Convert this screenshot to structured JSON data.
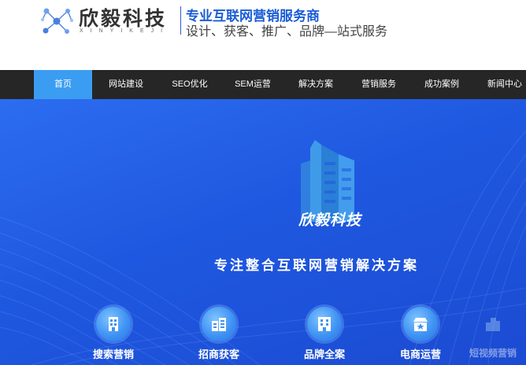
{
  "logo": {
    "name": "欣毅科技",
    "romanized": "XINYIKEJI",
    "icon": "molecule-network-icon"
  },
  "header": {
    "slogan_main": "专业互联网营销服务商",
    "slogan_sub": "设计、获客、推广、品牌—站式服务"
  },
  "nav": {
    "items": [
      {
        "label": "首页",
        "active": true
      },
      {
        "label": "网站建设"
      },
      {
        "label": "SEO优化"
      },
      {
        "label": "SEM运营"
      },
      {
        "label": "解决方案"
      },
      {
        "label": "营销服务"
      },
      {
        "label": "成功案例"
      },
      {
        "label": "新闻中心"
      }
    ]
  },
  "banner": {
    "brand": "欣毅科技",
    "tagline": "专注整合互联网营销解决方案",
    "services": [
      {
        "label": "搜索营销",
        "icon": "building-icon"
      },
      {
        "label": "招商获客",
        "icon": "buildings-icon"
      },
      {
        "label": "品牌全案",
        "icon": "office-icon"
      },
      {
        "label": "电商运营",
        "icon": "store-icon"
      },
      {
        "label": "短视频营销",
        "icon": "city-icon"
      }
    ]
  },
  "colors": {
    "accent": "#1a5cd6",
    "nav_bg": "#262626",
    "nav_active": "#3b9df2",
    "banner": "#1f58e0"
  }
}
